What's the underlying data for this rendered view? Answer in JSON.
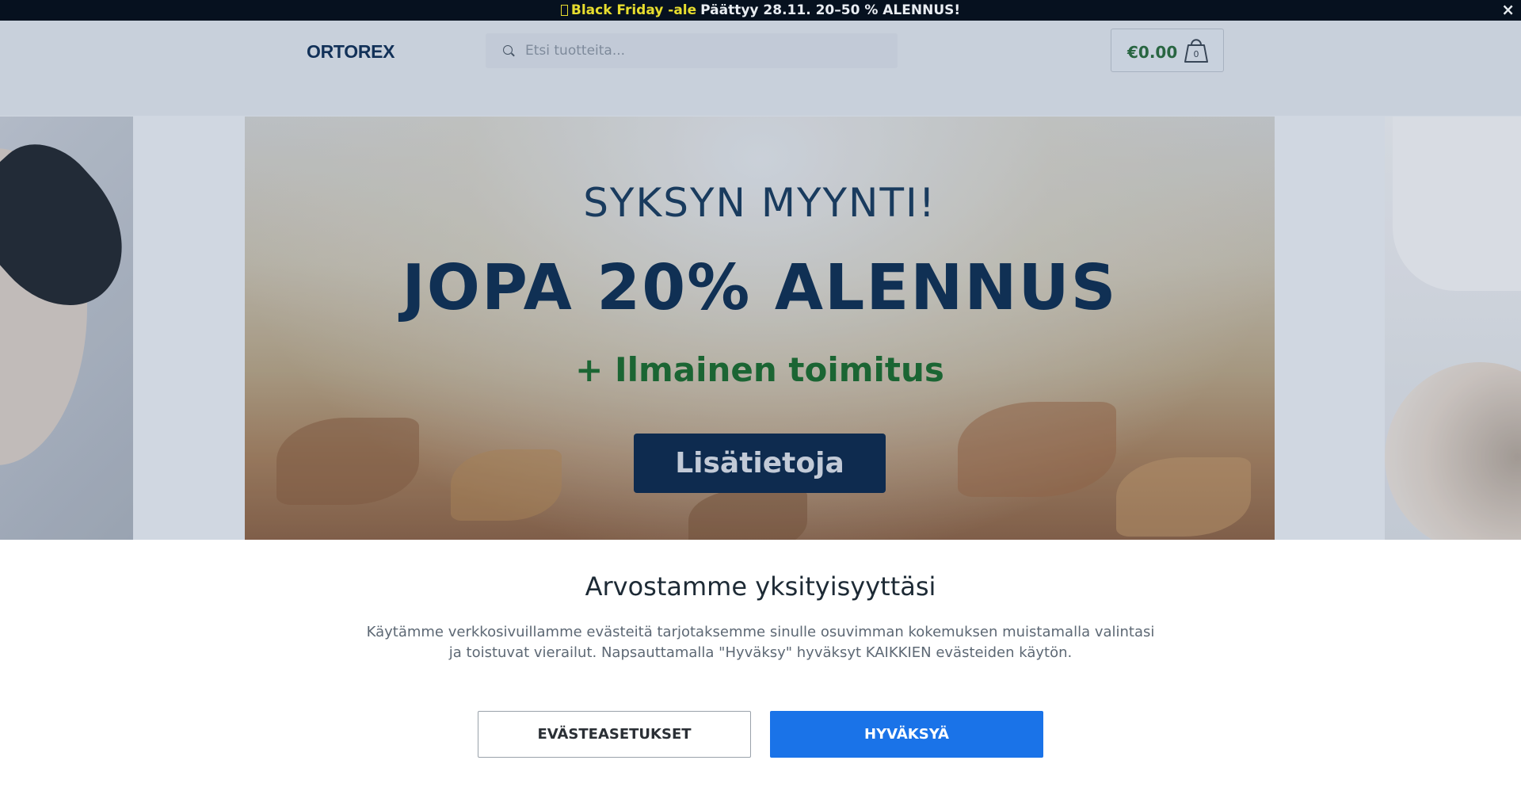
{
  "announcement": {
    "highlight": "Black Friday -ale",
    "text": "Päättyy 28.11. 20–50 % ALENNUS!",
    "icon": "promo-icon",
    "close_label": "×"
  },
  "header": {
    "logo": "ORTOREX",
    "search": {
      "placeholder": "Etsi tuotteita..."
    },
    "cart": {
      "total": "€0.00",
      "count": "0",
      "icon": "shopping-bag-icon"
    }
  },
  "hero": {
    "kicker": "SYKSYN MYYNTI!",
    "headline": "JOPA 20% ALENNUS",
    "subheadline": "+ Ilmainen toimitus",
    "cta_label": "Lisätietoja"
  },
  "cookie_banner": {
    "title": "Arvostamme yksityisyyttäsi",
    "body": "Käytämme verkkosivuillamme evästeitä tarjotaksemme sinulle osuvimman kokemuksen muistamalla valintasi ja toistuvat vierailut. Napsauttamalla \"Hyväksy\" hyväksyt KAIKKIEN evästeiden käytön.",
    "settings_label": "EVÄSTEASETUKSET",
    "accept_label": "HYVÄKSYÄ"
  },
  "colors": {
    "topbar_bg": "#06111f",
    "brand_navy": "#0d2f52",
    "brand_green": "#1a6b2d",
    "accept_blue": "#1a73e8"
  }
}
